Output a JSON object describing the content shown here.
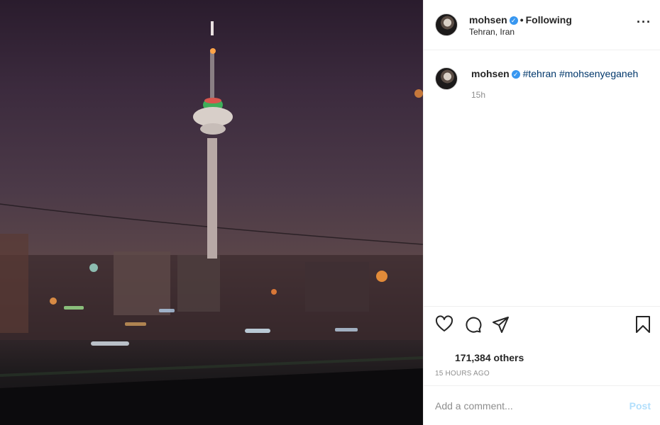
{
  "post": {
    "image_alt": "Milad Tower at night, Tehran"
  },
  "header": {
    "username": "mohsen",
    "verified_icon": "verified-badge-icon",
    "separator": "•",
    "follow_status": "Following",
    "location": "Tehran, Iran",
    "more_icon": "more-options-icon"
  },
  "caption": {
    "username": "mohsen",
    "hashtags": [
      "#tehran",
      "#mohsenyeganeh"
    ],
    "time": "15h"
  },
  "actions": {
    "like_icon": "heart-icon",
    "comment_icon": "comment-icon",
    "share_icon": "share-icon",
    "save_icon": "bookmark-icon"
  },
  "likes": {
    "text": "171,384 others"
  },
  "post_date": "15 HOURS AGO",
  "comment": {
    "placeholder": "Add a comment...",
    "post_label": "Post"
  },
  "colors": {
    "verified": "#3897f0",
    "hashtag": "#00376b",
    "post_disabled": "#b2dffc",
    "muted": "#8e8e8e"
  }
}
